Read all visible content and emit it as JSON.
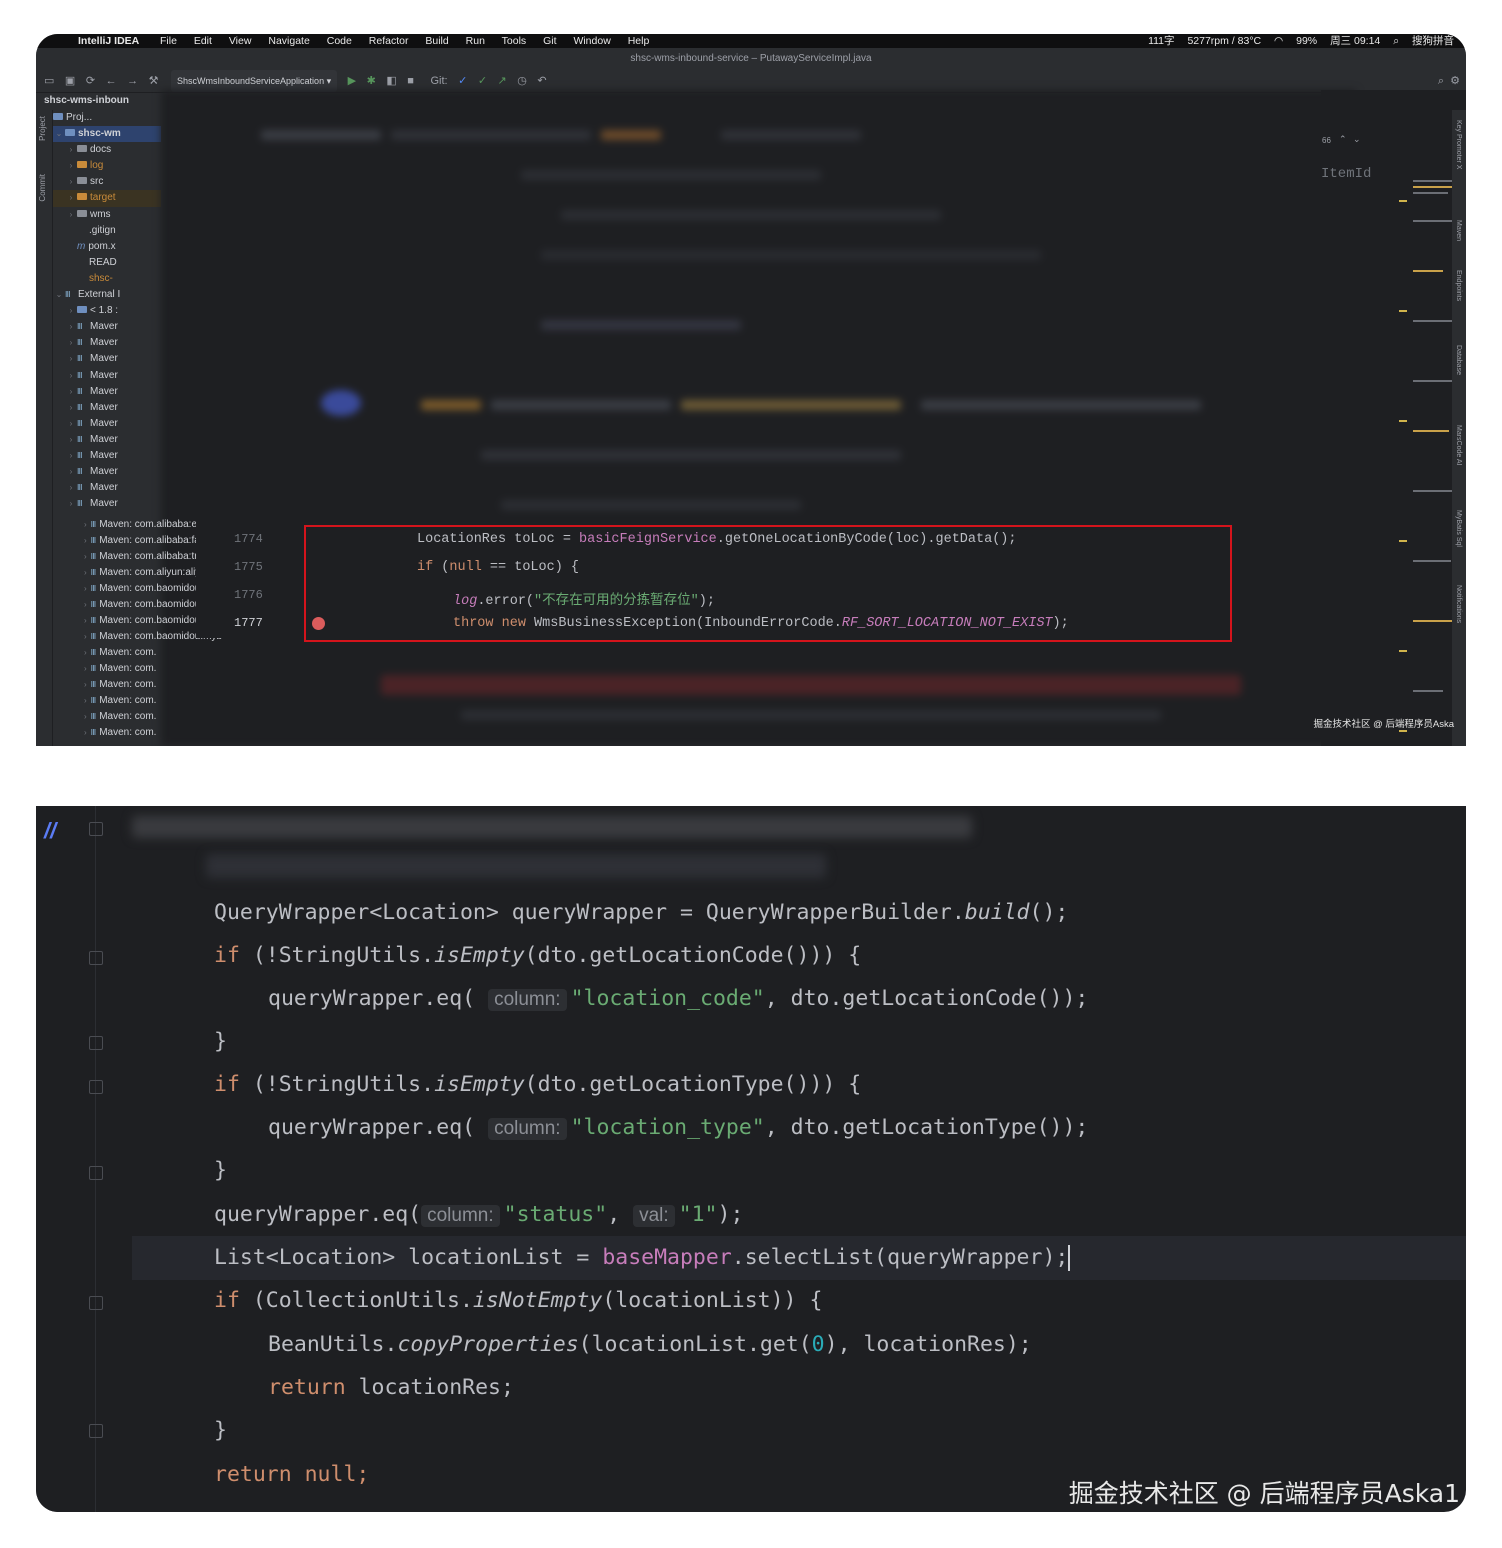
{
  "menubar": {
    "app": "IntelliJ IDEA",
    "menus": [
      "File",
      "Edit",
      "View",
      "Navigate",
      "Code",
      "Refactor",
      "Build",
      "Run",
      "Tools",
      "Git",
      "Window",
      "Help"
    ],
    "status": [
      "111字",
      "5277rpm / 83°C",
      "99%",
      "周三 09:14",
      "搜狗拼音"
    ]
  },
  "window": {
    "title": "shsc-wms-inbound-service – PutawayServiceImpl.java",
    "run_config": "ShscWmsInboundServiceApplication",
    "git_label": "Git:"
  },
  "project": {
    "breadcrumb": "shsc-wms-inboun",
    "panel_label": "Proj...",
    "strip_labels": [
      "Project",
      "Commit"
    ],
    "root": "shsc-wm",
    "items": [
      "docs",
      "log",
      "src",
      "target",
      "wms",
      ".gitign",
      "pom.x",
      "READ",
      "shsc-"
    ],
    "external": "External I",
    "jdk": "< 1.8 :",
    "maven_short": [
      "Maver",
      "Maver",
      "Maver",
      "Maver",
      "Maver",
      "Maver",
      "Maver",
      "Maver",
      "Maver",
      "Maver",
      "Maver",
      "Maver"
    ],
    "maven_long": [
      "Maven: com.alibaba:easyex",
      "Maven: com.alibaba:fastjso",
      "Maven: com.alibaba:transm",
      "Maven: com.aliyun:aliyun-ja",
      "Maven: com.baomidou:myb",
      "Maven: com.baomidou:myb",
      "Maven: com.baomidou:myb",
      "Maven: com.baomidou:myb",
      "Maven: com.",
      "Maven: com.",
      "Maven: com.",
      "Maven: com.",
      "Maven: com.",
      "Maven: com."
    ]
  },
  "editor1": {
    "line_numbers": [
      "1774",
      "1775",
      "1776",
      "1777"
    ],
    "find_count": "66",
    "find_text": "ItemId",
    "right_tools": [
      "Key Promoter X",
      "Maven",
      "Endpoints",
      "Database",
      "MarsCode AI",
      "MyBatis Sql",
      "Notifications"
    ]
  },
  "snippet1": {
    "line1_type": "LocationRes toLoc = ",
    "line1_field": "basicFeignService",
    "line1_call": ".getOneLocationByCode(loc).getData();",
    "line2_kw": "if",
    "line2_rest": " (",
    "line2_null": "null",
    "line2_end": " == toLoc) {",
    "line3_log": "log",
    "line3_call": ".error(",
    "line3_str": "\"不存在可用的分拣暂存位\"",
    "line3_end": ");",
    "line4_throw": "throw",
    "line4_new": "new",
    "line4_cls": " WmsBusinessException(InboundErrorCode.",
    "line4_const": "RF_SORT_LOCATION_NOT_EXIST",
    "line4_end": ");"
  },
  "watermark_small": "掘金技术社区 @ 后端程序员Aska",
  "snippet2": {
    "l1_a": "QueryWrapper<Location> queryWrapper = QueryWrapperBuilder.",
    "l1_b": "build",
    "l1_c": "();",
    "l2_kw": "if",
    "l2_a": " (!StringUtils.",
    "l2_b": "isEmpty",
    "l2_c": "(dto.getLocationCode())) {",
    "l3_a": "queryWrapper.eq(",
    "hint_column": "column:",
    "l3_str": "\"location_code\"",
    "l3_b": ", dto.getLocationCode());",
    "close": "}",
    "l5_a": " (!StringUtils.",
    "l5_c": "(dto.getLocationType())) {",
    "l6_str": "\"location_type\"",
    "l6_b": ", dto.getLocationType());",
    "l8_str": "\"status\"",
    "hint_val": "val:",
    "l8_val": "\"1\"",
    "l8_end": ");",
    "l9_a": "List<Location> locationList = ",
    "l9_field": "baseMapper",
    "l9_b": ".selectList(queryWrapper);",
    "l10_a": " (CollectionUtils.",
    "l10_b": "isNotEmpty",
    "l10_c": "(locationList)) {",
    "l11_a": "BeanUtils.",
    "l11_b": "copyProperties",
    "l11_c": "(locationList.get(",
    "l11_num": "0",
    "l11_d": "), locationRes);",
    "ret_kw": "return",
    "l12_b": " locationRes;",
    "l14_b": " null;"
  },
  "watermark_large": "掘金技术社区 @ 后端程序员Aska1"
}
